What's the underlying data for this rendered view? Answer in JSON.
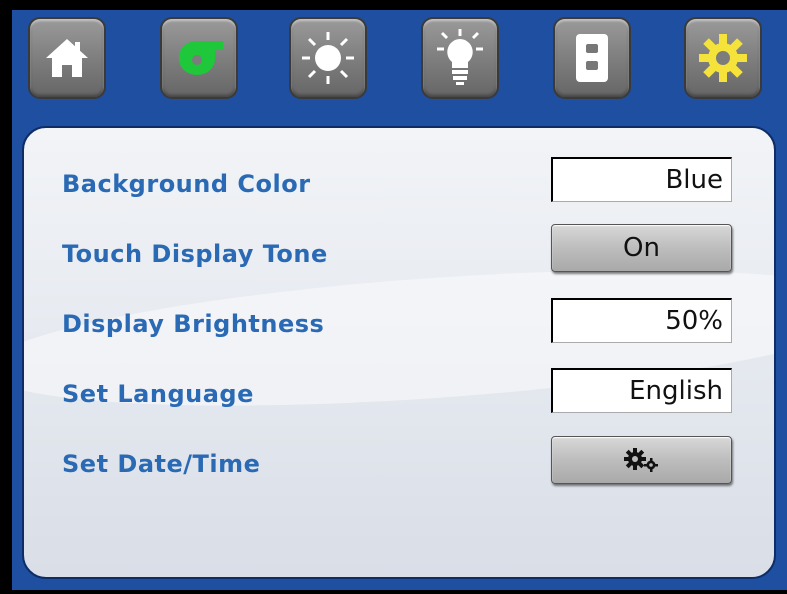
{
  "nav": {
    "tabs": [
      {
        "icon": "home-icon"
      },
      {
        "icon": "fan-icon",
        "color": "#1ec83a"
      },
      {
        "icon": "sun-icon"
      },
      {
        "icon": "lightbulb-icon"
      },
      {
        "icon": "wall-switch-icon"
      },
      {
        "icon": "gear-icon",
        "color": "#f5e23a",
        "active": true
      }
    ]
  },
  "settings": {
    "background_color": {
      "label": "Background Color",
      "value": "Blue"
    },
    "touch_tone": {
      "label": "Touch Display Tone",
      "value": "On"
    },
    "brightness": {
      "label": "Display Brightness",
      "value": "50%"
    },
    "language": {
      "label": "Set Language",
      "value": "English"
    },
    "date_time": {
      "label": "Set Date/Time",
      "icon": "gears-icon"
    }
  },
  "colors": {
    "frame": "#1f4fa0",
    "label_text": "#2a6ab4"
  }
}
